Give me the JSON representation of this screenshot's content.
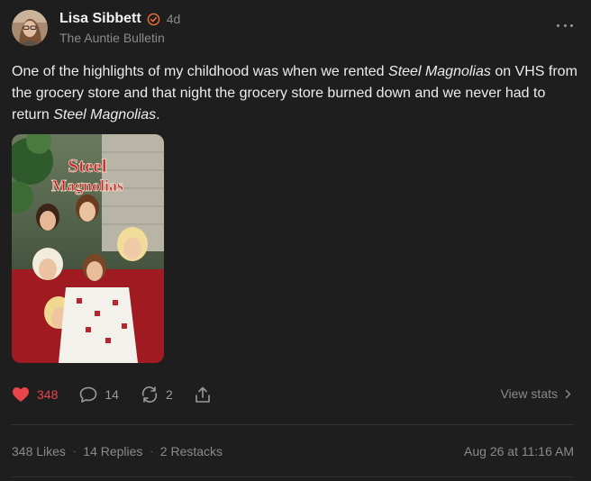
{
  "post": {
    "author": "Lisa Sibbett",
    "time": "4d",
    "publication": "The Auntie Bulletin",
    "body": {
      "t1": "One of the highlights of my childhood was when we rented ",
      "em1": "Steel Magnolias",
      "t2": " on VHS from the grocery store and that night the grocery store burned down and we never had to return ",
      "em2": "Steel Magnolias",
      "t3": "."
    },
    "image": {
      "title_line1": "Steel",
      "title_line2": "Magnolias"
    }
  },
  "actions": {
    "likes": "348",
    "replies": "14",
    "restacks": "2",
    "view_stats": "View stats"
  },
  "stats": {
    "likes": "348 Likes",
    "sep1": "·",
    "replies": "14 Replies",
    "sep2": "·",
    "restacks": "2 Restacks",
    "timestamp": "Aug 26 at 11:16 AM"
  },
  "colors": {
    "background": "#1e1e1e",
    "accent_like": "#e8454b",
    "verified": "#f0703a"
  },
  "icons": [
    "verified-badge-icon",
    "more-icon",
    "heart-icon",
    "comment-icon",
    "restack-icon",
    "share-icon",
    "chevron-right-icon"
  ]
}
